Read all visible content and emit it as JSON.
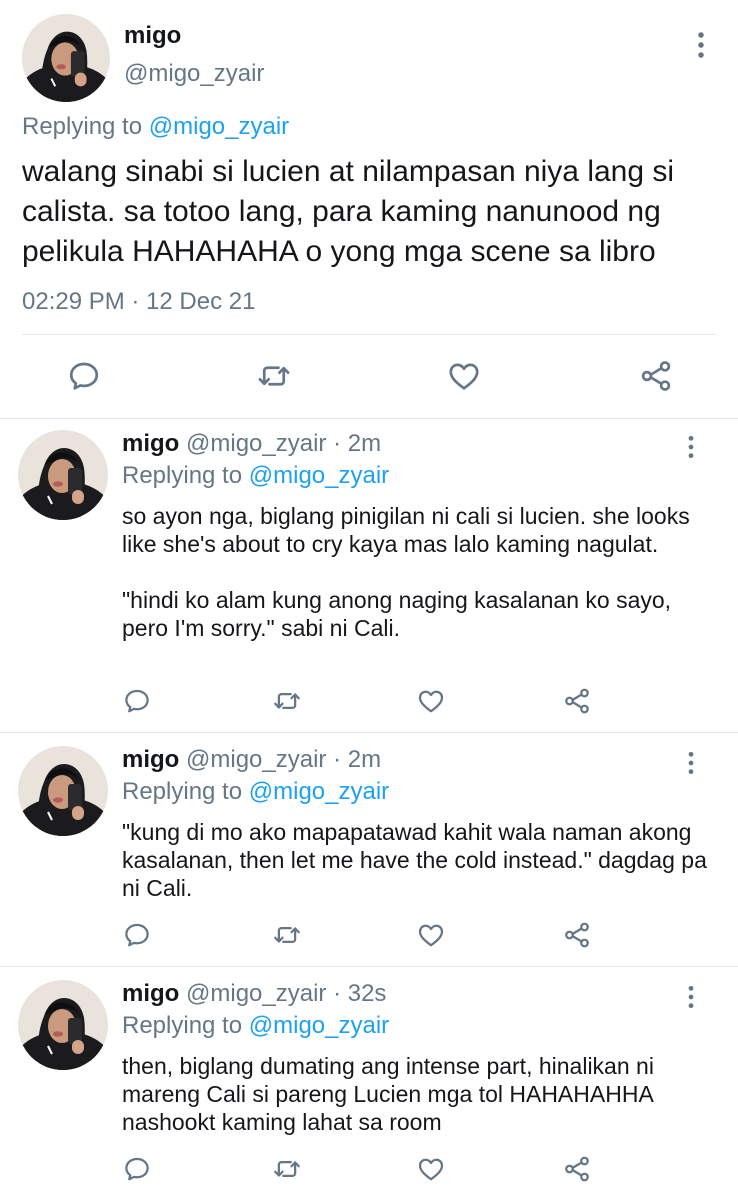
{
  "main_tweet": {
    "display_name": "migo",
    "handle": "@migo_zyair",
    "replying_prefix": "Replying to",
    "replying_to": "@migo_zyair",
    "text": "walang sinabi si lucien at nilampasan niya lang si calista. sa totoo lang, para kaming nanunood ng pelikula HAHAHAHA o yong mga scene sa libro",
    "timestamp": "02:29 PM · 12 Dec 21",
    "actions": [
      "reply-icon",
      "retweet-icon",
      "like-icon",
      "share-icon"
    ]
  },
  "replies": [
    {
      "display_name": "migo",
      "handle": "@migo_zyair",
      "time": "· 2m",
      "replying_prefix": "Replying to",
      "replying_to": "@migo_zyair",
      "text": "so ayon nga, biglang pinigilan ni cali si lucien. she looks like she's about to cry kaya mas lalo kaming nagulat.\n\n\"hindi ko alam kung anong naging kasalanan ko sayo, pero I'm sorry.\" sabi ni Cali."
    },
    {
      "display_name": "migo",
      "handle": "@migo_zyair",
      "time": "· 2m",
      "replying_prefix": "Replying to",
      "replying_to": "@migo_zyair",
      "text": "\"kung di mo ako mapapatawad kahit wala naman akong kasalanan, then let me have the cold instead.\" dagdag pa ni Cali."
    },
    {
      "display_name": "migo",
      "handle": "@migo_zyair",
      "time": "· 32s",
      "replying_prefix": "Replying to",
      "replying_to": "@migo_zyair",
      "text": "then, biglang dumating ang intense part, hinalikan ni mareng Cali si pareng Lucien mga tol HAHAHAHHA nashookt kaming lahat sa room"
    }
  ],
  "colors": {
    "accent": "#1da1f2",
    "secondary_text": "#657786",
    "divider": "#e1e8ed",
    "icon": "#657786"
  }
}
